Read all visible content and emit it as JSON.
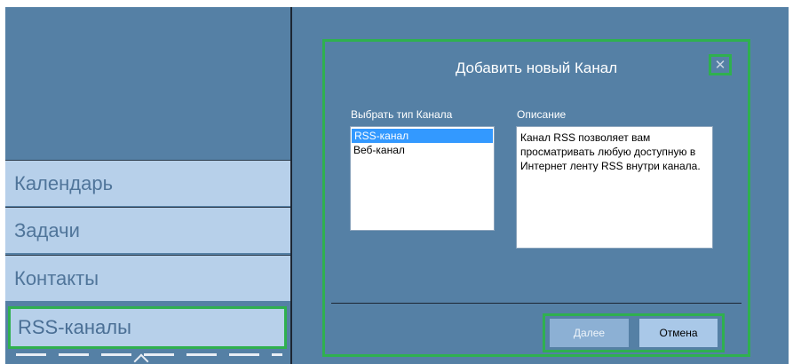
{
  "sidebar": {
    "items": [
      {
        "label": "Календарь"
      },
      {
        "label": "Задачи"
      },
      {
        "label": "Контакты"
      },
      {
        "label": "RSS-каналы",
        "active": true
      }
    ]
  },
  "dialog": {
    "title": "Добавить новый Канал",
    "close_symbol": "✕",
    "type_label": "Выбрать тип Канала",
    "types": [
      {
        "label": "RSS-канал",
        "selected": true
      },
      {
        "label": "Веб-канал",
        "selected": false
      }
    ],
    "description_label": "Описание",
    "description_text": "Канал RSS позволяет вам просматривать любую доступную в Интернет ленту RSS внутри канала.",
    "buttons": {
      "next": "Далее",
      "cancel": "Отмена"
    }
  },
  "colors": {
    "background": "#5580a5",
    "nav_item": "#b7d0ea",
    "highlight": "#2fb04f",
    "selection": "#3399ff"
  }
}
